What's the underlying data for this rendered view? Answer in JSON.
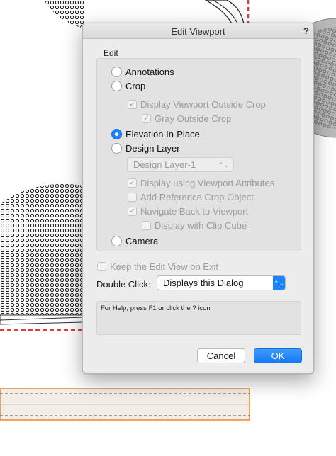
{
  "dialog": {
    "title": "Edit Viewport",
    "help_glyph": "?",
    "edit_group_label": "Edit",
    "options": {
      "annotations": "Annotations",
      "crop": "Crop",
      "display_outside_crop": "Display Viewport Outside Crop",
      "gray_outside_crop": "Gray Outside Crop",
      "elevation_in_place": "Elevation In-Place",
      "design_layer": "Design Layer",
      "design_layer_select": "Design Layer-1",
      "display_using_attrs": "Display using Viewport Attributes",
      "add_reference_crop": "Add Reference Crop Object",
      "navigate_back": "Navigate Back to Viewport",
      "display_clip_cube": "Display with Clip Cube",
      "camera": "Camera"
    },
    "selected_mode": "elevation_in_place",
    "keep_edit_view": "Keep the Edit View on Exit",
    "double_click_label": "Double Click:",
    "double_click_value": "Displays this Dialog",
    "help_text": "For Help, press F1 or click the ? icon",
    "cancel_label": "Cancel",
    "ok_label": "OK",
    "check_glyph": "✓",
    "arrows_glyph": "⌃⌄"
  },
  "colors": {
    "accent": "#1a82fb",
    "red_dash": "#e03a3a",
    "orange_bar": "#e8892b",
    "dots": "#111111"
  },
  "icons": {
    "radio_selected": "radio-filled-icon",
    "check": "checkmark-icon",
    "popup": "chevron-up-down-icon"
  }
}
